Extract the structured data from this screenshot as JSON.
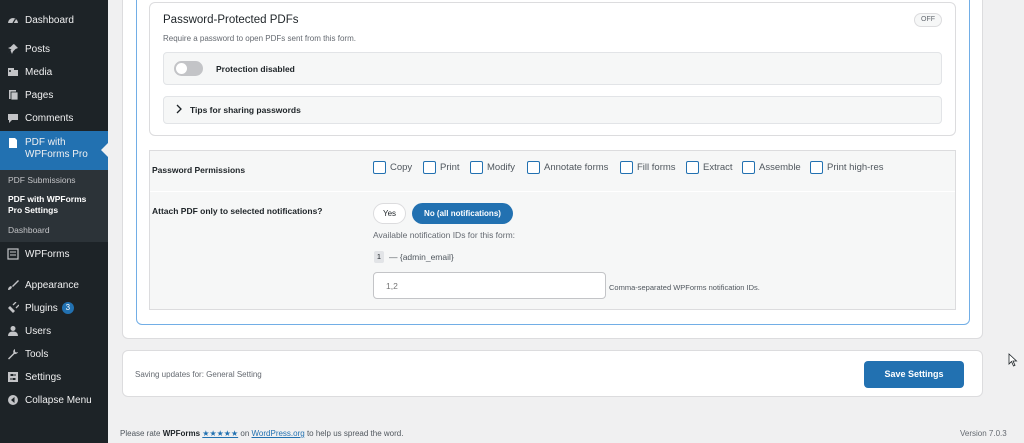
{
  "sidebar": {
    "menu": [
      {
        "label": "Dashboard",
        "icon": "dashboard-icon"
      },
      {
        "label": "Posts",
        "icon": "pin-icon"
      },
      {
        "label": "Media",
        "icon": "media-icon"
      },
      {
        "label": "Pages",
        "icon": "pages-icon"
      },
      {
        "label": "Comments",
        "icon": "comment-icon"
      },
      {
        "label": "PDF with WPForms Pro",
        "icon": "document-icon"
      },
      {
        "label": "WPForms",
        "icon": "form-icon"
      },
      {
        "label": "Appearance",
        "icon": "brush-icon"
      },
      {
        "label": "Plugins",
        "icon": "plug-icon",
        "badge": "3"
      },
      {
        "label": "Users",
        "icon": "user-icon"
      },
      {
        "label": "Tools",
        "icon": "wrench-icon"
      },
      {
        "label": "Settings",
        "icon": "settings-icon"
      },
      {
        "label": "Collapse Menu",
        "icon": "collapse-icon"
      }
    ],
    "submenu": [
      "PDF Submissions",
      "PDF with WPForms Pro Settings",
      "Dashboard"
    ]
  },
  "password_pdfs": {
    "title": "Password-Protected PDFs",
    "description": "Require a password to open PDFs sent from this form.",
    "status_pill": "OFF",
    "toggle_label": "Protection disabled",
    "toggle_on": false,
    "tips_label": "Tips for sharing passwords"
  },
  "permissions": {
    "label": "Password Permissions",
    "options": [
      "Copy",
      "Print",
      "Modify",
      "Annotate forms",
      "Fill forms",
      "Extract",
      "Assemble",
      "Print high-res"
    ]
  },
  "attach": {
    "label": "Attach PDF only to selected notifications?",
    "yes_label": "Yes",
    "no_label": "No (all notifications)",
    "available_text": "Available notification IDs for this form:",
    "id_chip": "1",
    "id_text": "— {admin_email}",
    "input_placeholder": "1,2",
    "input_hint": "Comma-separated WPForms notification IDs."
  },
  "save_bar": {
    "text": "Saving updates for: General Setting",
    "button": "Save Settings"
  },
  "footer": {
    "prefix": "Please rate",
    "brand": "WPForms",
    "stars": "★★★★★",
    "on": "on",
    "link": "WordPress.org",
    "suffix": "to help us spread the word.",
    "version": "Version 7.0.3"
  },
  "colors": {
    "accent": "#2271b1",
    "sidebar_bg": "#1d2327",
    "page_bg": "#f0f0f1"
  }
}
